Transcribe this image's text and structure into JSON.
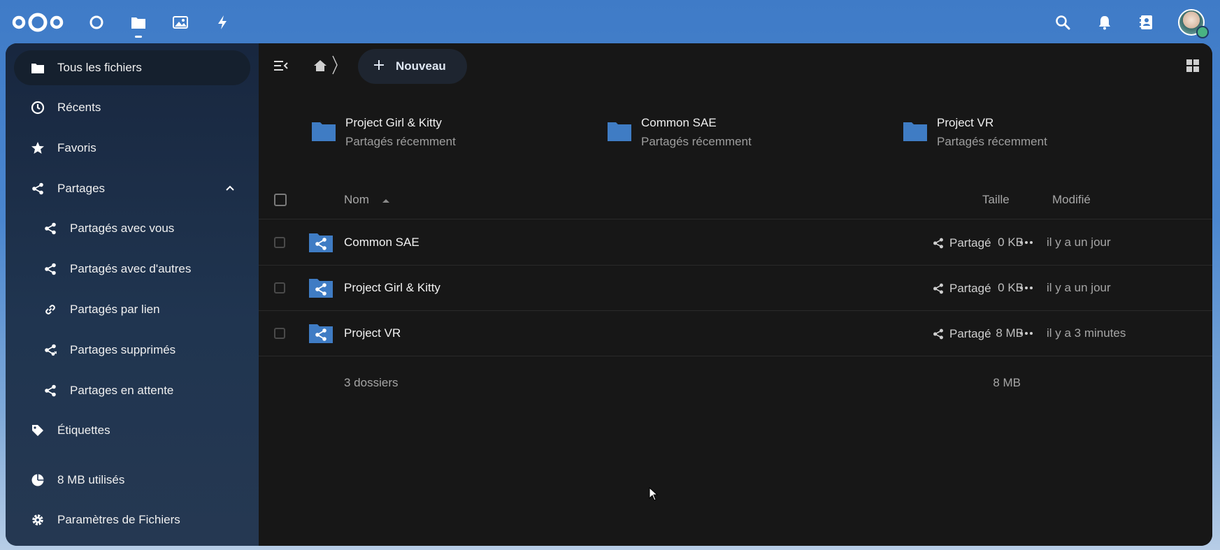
{
  "header": {
    "apps": [
      "dashboard-icon",
      "files-icon",
      "photos-icon",
      "activity-icon"
    ],
    "right": [
      "search-icon",
      "notifications-icon",
      "contacts-icon"
    ]
  },
  "sidebar": {
    "items": [
      {
        "label": "Tous les fichiers",
        "icon": "folder-icon"
      },
      {
        "label": "Récents",
        "icon": "clock-icon"
      },
      {
        "label": "Favoris",
        "icon": "star-icon"
      },
      {
        "label": "Partages",
        "icon": "share-icon"
      },
      {
        "label": "Partagés avec vous",
        "icon": "share-icon"
      },
      {
        "label": "Partagés avec d'autres",
        "icon": "share-icon"
      },
      {
        "label": "Partagés par lien",
        "icon": "link-icon"
      },
      {
        "label": "Partages supprimés",
        "icon": "share-deleted-icon"
      },
      {
        "label": "Partages en attente",
        "icon": "share-icon"
      },
      {
        "label": "Étiquettes",
        "icon": "tag-icon"
      }
    ],
    "quota": "8 MB utilisés",
    "settings": "Paramètres de Fichiers"
  },
  "toolbar": {
    "new_label": "Nouveau"
  },
  "recent": [
    {
      "name": "Project Girl & Kitty",
      "sub": "Partagés récemment"
    },
    {
      "name": "Common SAE",
      "sub": "Partagés récemment"
    },
    {
      "name": "Project VR",
      "sub": "Partagés récemment"
    }
  ],
  "table": {
    "headers": {
      "name": "Nom",
      "size": "Taille",
      "modified": "Modifié"
    },
    "rows": [
      {
        "name": "Common SAE",
        "share": "Partagé",
        "size": "0 KB",
        "modified": "il y a un jour"
      },
      {
        "name": "Project Girl & Kitty",
        "share": "Partagé",
        "size": "0 KB",
        "modified": "il y a un jour"
      },
      {
        "name": "Project VR",
        "share": "Partagé",
        "size": "8 MB",
        "modified": "il y a 3 minutes"
      }
    ],
    "summary": {
      "count": "3 dossiers",
      "size": "8 MB"
    }
  },
  "colors": {
    "accent": "#3f7bc7",
    "folder": "#3f7cc4",
    "panel": "#171717"
  }
}
